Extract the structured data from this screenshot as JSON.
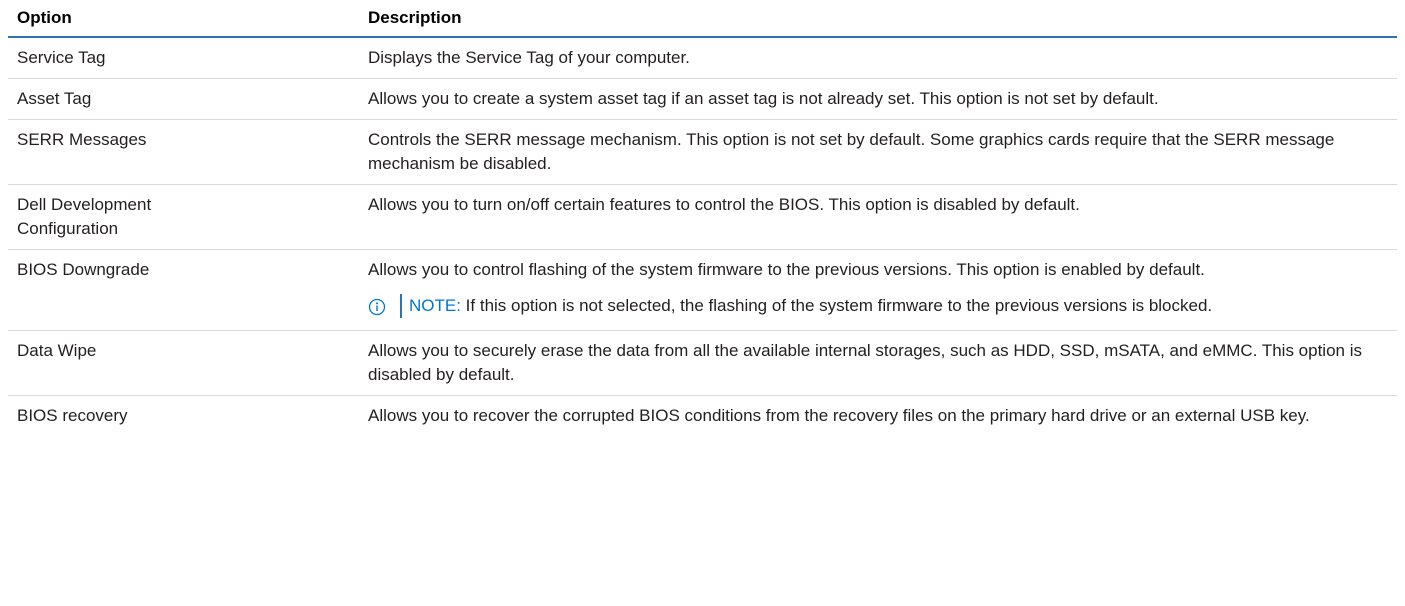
{
  "table": {
    "headers": {
      "option": "Option",
      "description": "Description"
    },
    "rows": [
      {
        "option": "Service Tag",
        "description": "Displays the Service Tag of your computer."
      },
      {
        "option": "Asset Tag",
        "description": "Allows you to create a system asset tag if an asset tag is not already set. This option is not set by default."
      },
      {
        "option": "SERR Messages",
        "description": "Controls the SERR message mechanism. This option is not set by default. Some graphics cards require that the SERR message mechanism be disabled."
      },
      {
        "option": "Dell Development Configuration",
        "description": "Allows you to turn on/off certain features to control the BIOS. This option is disabled by default."
      },
      {
        "option": "BIOS Downgrade",
        "description": "Allows you to control flashing of the system firmware to the previous versions. This option is enabled by default.",
        "note": {
          "label": "NOTE:",
          "text": " If this option is not selected, the flashing of the system firmware to the previous versions is blocked."
        }
      },
      {
        "option": "Data Wipe",
        "description": "Allows you to securely erase the data from all the available internal storages, such as HDD, SSD, mSATA, and eMMC. This option is disabled by default."
      },
      {
        "option": "BIOS recovery",
        "description": "Allows you to recover the corrupted BIOS conditions from the recovery files on the primary hard drive or an external USB key."
      }
    ]
  },
  "colors": {
    "header_rule": "#2e74b5",
    "note_label": "#0076ce",
    "row_divider": "#d9d9d9"
  },
  "icons": {
    "note": "info-circle-icon"
  }
}
